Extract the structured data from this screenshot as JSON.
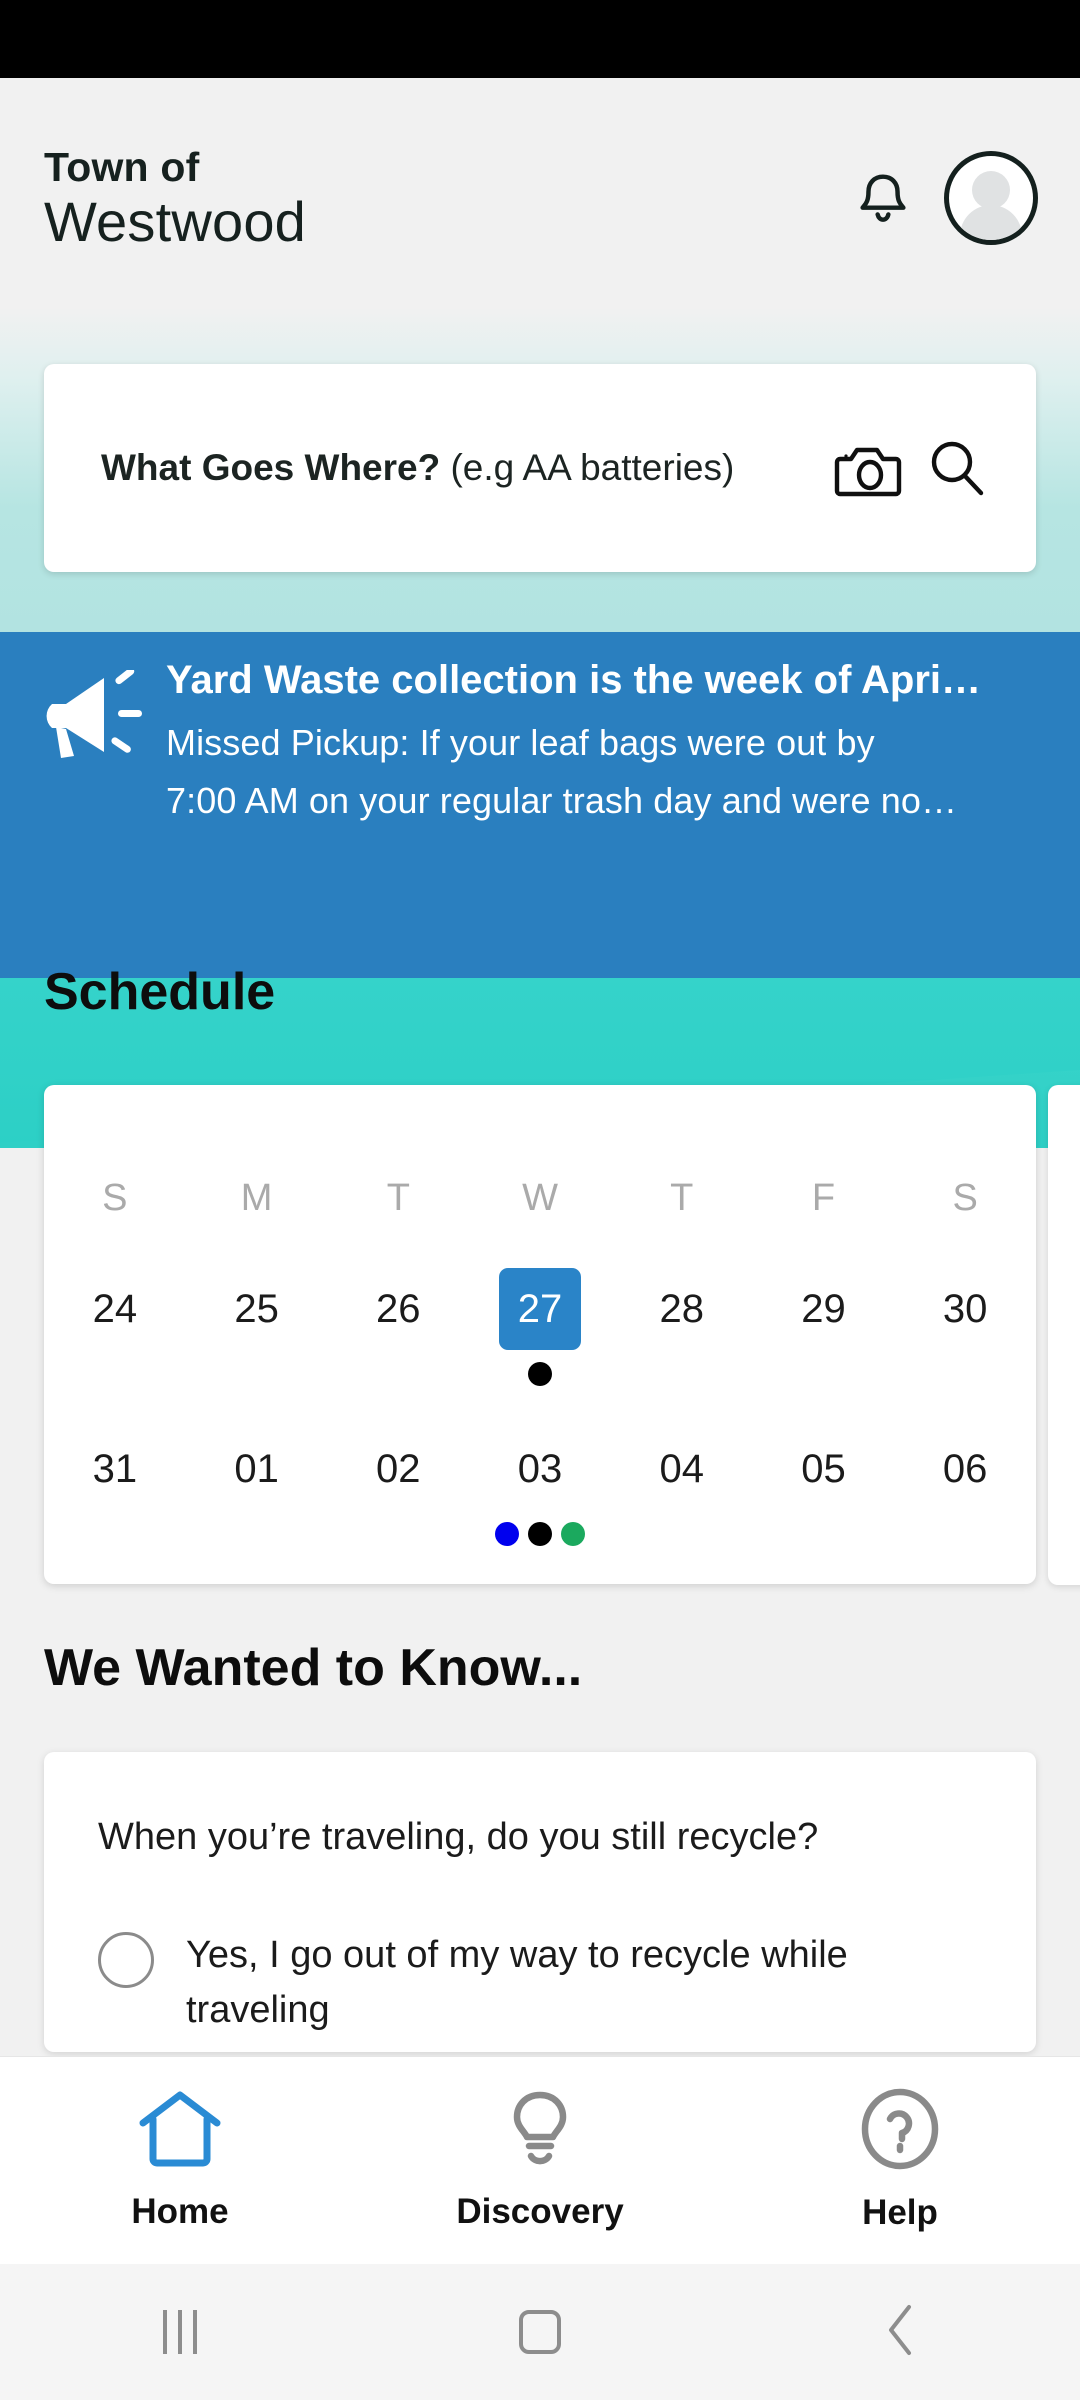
{
  "status_bar": {
    "background": "#000000"
  },
  "header": {
    "town_prefix": "Town of",
    "town_name": "Westwood",
    "notifications_icon": "bell-icon",
    "avatar_icon": "user-avatar-icon"
  },
  "search": {
    "label": "What Goes Where?",
    "hint": "(e.g AA batteries)",
    "camera_icon": "camera-icon",
    "search_icon": "magnifier-icon"
  },
  "announcement": {
    "icon": "megaphone-icon",
    "title": "Yard Waste collection is the week of Apri…",
    "line1": "Missed Pickup:  If your leaf bags were out by",
    "line2": "7:00 AM on your regular trash day and were no…",
    "background": "#2A7FBF"
  },
  "schedule": {
    "title": "Schedule",
    "day_headers": [
      "S",
      "M",
      "T",
      "W",
      "T",
      "F",
      "S"
    ],
    "weeks": [
      {
        "days": [
          {
            "label": "24",
            "selected": false,
            "dots": []
          },
          {
            "label": "25",
            "selected": false,
            "dots": []
          },
          {
            "label": "26",
            "selected": false,
            "dots": []
          },
          {
            "label": "27",
            "selected": true,
            "dots": [
              "#000000"
            ]
          },
          {
            "label": "28",
            "selected": false,
            "dots": []
          },
          {
            "label": "29",
            "selected": false,
            "dots": []
          },
          {
            "label": "30",
            "selected": false,
            "dots": []
          }
        ]
      },
      {
        "days": [
          {
            "label": "31",
            "selected": false,
            "dots": []
          },
          {
            "label": "01",
            "selected": false,
            "dots": []
          },
          {
            "label": "02",
            "selected": false,
            "dots": []
          },
          {
            "label": "03",
            "selected": false,
            "dots": [
              "#0000EE",
              "#000000",
              "#1BA95E"
            ]
          },
          {
            "label": "04",
            "selected": false,
            "dots": []
          },
          {
            "label": "05",
            "selected": false,
            "dots": []
          },
          {
            "label": "06",
            "selected": false,
            "dots": []
          }
        ]
      }
    ],
    "selected_color": "#2A84C8"
  },
  "survey": {
    "title": "We Wanted to Know...",
    "question": "When you’re traveling, do you still recycle?",
    "options": [
      {
        "label": "Yes, I go out of my way to recycle while traveling",
        "selected": false
      }
    ]
  },
  "bottom_nav": {
    "active_color": "#2A8BD4",
    "inactive_color": "#8A8A8A",
    "items": [
      {
        "label": "Home",
        "icon": "home-icon",
        "active": true
      },
      {
        "label": "Discovery",
        "icon": "lightbulb-icon",
        "active": false
      },
      {
        "label": "Help",
        "icon": "question-circle-icon",
        "active": false
      }
    ]
  },
  "system_nav": {
    "recents_icon": "recents-icon",
    "home_icon": "home-square-icon",
    "back_icon": "chevron-left-icon"
  }
}
